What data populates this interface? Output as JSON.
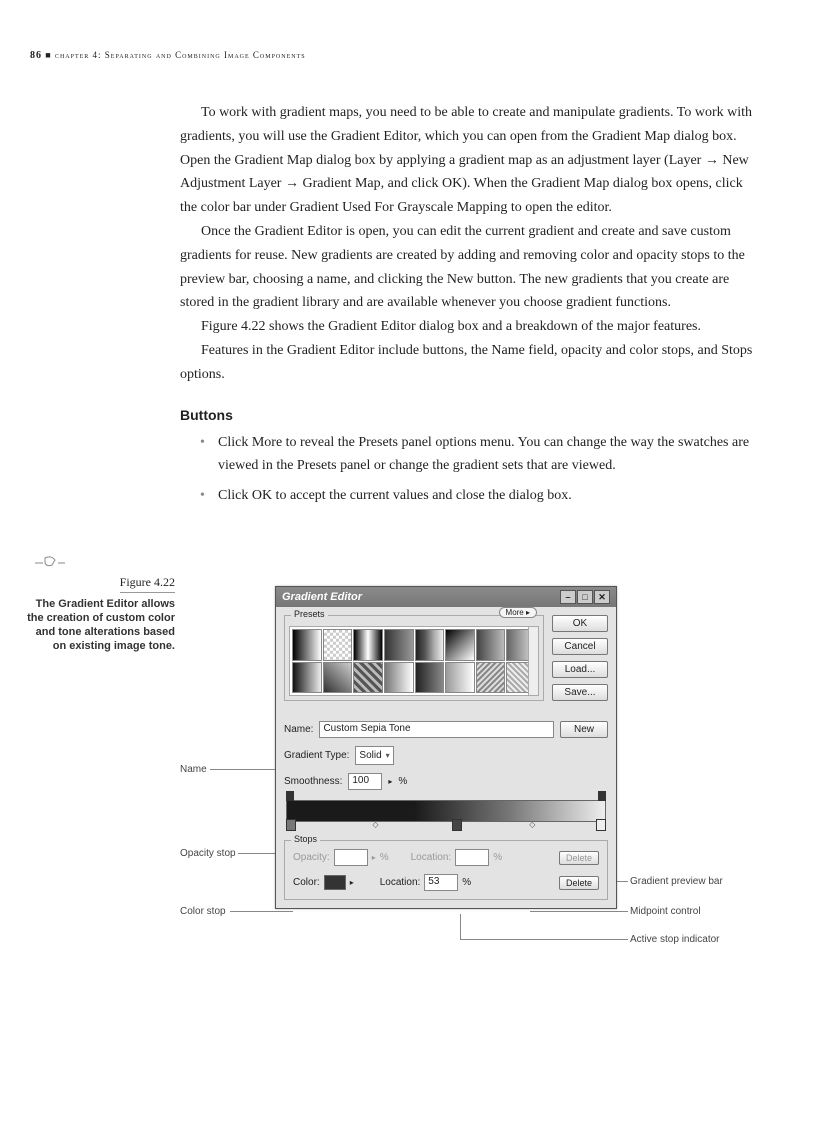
{
  "header": {
    "page_number": "86",
    "chapter": "chapter 4: Separating and Combining Image Components"
  },
  "paragraphs": {
    "p1": "To work with gradient maps, you need to be able to create and manipulate gradients. To work with gradients, you will use the Gradient Editor, which you can open from the Gradient Map dialog box. Open the Gradient Map dialog box by applying a gradient map as an adjustment layer (Layer → New Adjustment Layer → Gradient Map, and click OK). When the Gradient Map dialog box opens, click the color bar under Gradient Used For Grayscale Mapping to open the editor.",
    "p2": "Once the Gradient Editor is open, you can edit the current gradient and create and save custom gradients for reuse. New gradients are created by adding and removing color and opacity stops to the preview bar, choosing a name, and clicking the New button. The new gradients that you create are stored in the gradient library and are available whenever you choose gradient functions.",
    "p3": "Figure 4.22 shows the Gradient Editor dialog box and a breakdown of the major features.",
    "p4": "Features in the Gradient Editor include buttons, the Name field, opacity and color stops, and Stops options."
  },
  "section_head": "Buttons",
  "bullets": {
    "b1": "Click More to reveal the Presets panel options menu. You can change the way the swatches are viewed in the Presets panel or change the gradient sets that are viewed.",
    "b2": "Click OK to accept the current values and close the dialog box."
  },
  "sidebar": {
    "fig_num": "Figure 4.22",
    "caption": "The Gradient Editor allows the creation of custom color and tone alterations based on existing image tone."
  },
  "dialog": {
    "title": "Gradient Editor",
    "presets_label": "Presets",
    "more": "More ▸",
    "ok": "OK",
    "cancel": "Cancel",
    "load": "Load...",
    "save": "Save...",
    "name_label": "Name:",
    "name_value": "Custom Sepia Tone",
    "new": "New",
    "gradtype_label": "Gradient Type:",
    "gradtype_value": "Solid",
    "smooth_label": "Smoothness:",
    "smooth_value": "100",
    "percent": "%",
    "stops_label": "Stops",
    "opacity_label": "Opacity:",
    "location_label": "Location:",
    "color_label": "Color:",
    "location_value": "53",
    "delete": "Delete"
  },
  "callouts": {
    "name": "Name",
    "opacity_stop": "Opacity stop",
    "color_stop": "Color stop",
    "gradient_preview": "Gradient preview bar",
    "midpoint": "Midpoint control",
    "active_stop": "Active stop indicator"
  }
}
